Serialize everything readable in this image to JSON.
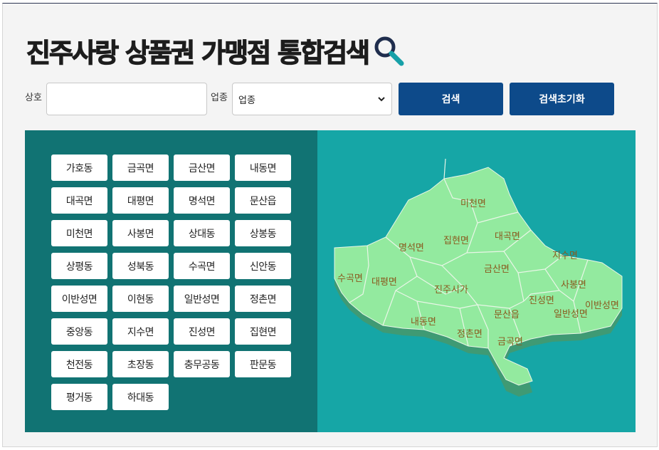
{
  "page": {
    "title": "진주사랑 상품권 가맹점 통합검색",
    "search_icon": "magnifier-icon"
  },
  "form": {
    "name_label": "상호",
    "name_value": "",
    "type_label": "업종",
    "type_selected": "업종",
    "search_button": "검색",
    "reset_button": "검색초기화"
  },
  "regions": [
    "가호동",
    "금곡면",
    "금산면",
    "내동면",
    "대곡면",
    "대평면",
    "명석면",
    "문산읍",
    "미천면",
    "사봉면",
    "상대동",
    "상봉동",
    "상평동",
    "성북동",
    "수곡면",
    "신안동",
    "이반성면",
    "이현동",
    "일반성면",
    "정촌면",
    "중앙동",
    "지수면",
    "진성면",
    "집현면",
    "천전동",
    "초장동",
    "충무공동",
    "판문동",
    "평거동",
    "하대동"
  ],
  "map": {
    "labels": {
      "michon": "미천면",
      "myeongseok": "명석면",
      "jiphyeon": "집현면",
      "daegok": "대곡면",
      "jisu": "지수면",
      "sugok": "수곡면",
      "daepyeong": "대평면",
      "city": "진주시가",
      "geumsan": "금산면",
      "sabong": "사봉면",
      "jinseong": "진성면",
      "ibanseong": "이반성면",
      "ilbanseong": "일반성면",
      "naedong": "내동면",
      "munsan": "문산읍",
      "jeongchon": "정촌면",
      "geumgok": "금곡면"
    },
    "colors": {
      "land": "#93ea9f",
      "shadow": "#3f9a74",
      "border": "#e9f6e7",
      "label": "#8a5a1e"
    }
  },
  "colors": {
    "button": "#0d4a8a",
    "panel_left": "#117373",
    "panel_right": "#16a6a6"
  }
}
